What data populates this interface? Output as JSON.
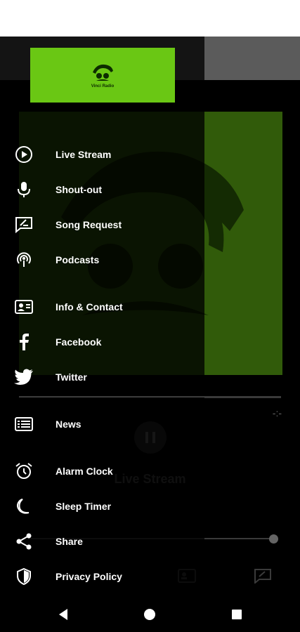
{
  "drawer": {
    "logo_text": "Vinci Radio",
    "items": [
      {
        "label": "Live Stream",
        "icon": "play-circle-icon"
      },
      {
        "label": "Shout-out",
        "icon": "microphone-icon"
      },
      {
        "label": "Song Request",
        "icon": "request-icon"
      },
      {
        "label": "Podcasts",
        "icon": "podcast-icon"
      },
      {
        "label": "Info & Contact",
        "icon": "contact-card-icon"
      },
      {
        "label": "Facebook",
        "icon": "facebook-icon"
      },
      {
        "label": "Twitter",
        "icon": "twitter-icon"
      },
      {
        "label": "News",
        "icon": "news-icon"
      },
      {
        "label": "Alarm Clock",
        "icon": "alarm-clock-icon"
      },
      {
        "label": "Sleep Timer",
        "icon": "moon-icon"
      },
      {
        "label": "Share",
        "icon": "share-icon"
      },
      {
        "label": "Privacy Policy",
        "icon": "shield-icon"
      }
    ]
  },
  "player": {
    "title": "Live Stream",
    "time": "-:-",
    "volume_fraction": 0.98
  },
  "colors": {
    "accent": "#6ac714",
    "art_background": "#4c8c10"
  }
}
